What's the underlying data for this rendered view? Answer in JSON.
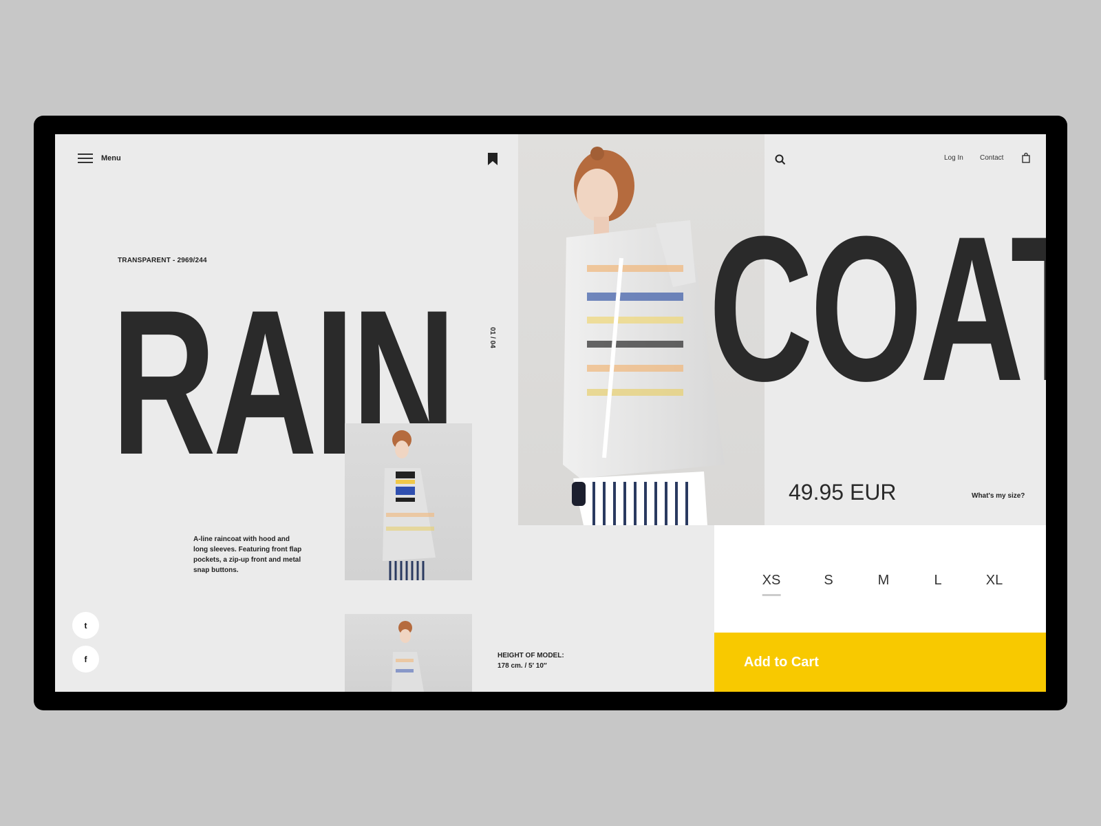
{
  "header": {
    "menu_label": "Menu",
    "nav_login": "Log In",
    "nav_contact": "Contact"
  },
  "product": {
    "sku": "TRANSPARENT - 2969/244",
    "title_left": "RAIN",
    "title_right": "COAT",
    "counter": "01 / 04",
    "description": "A-line raincoat with hood and long sleeves. Featuring front flap pockets, a zip-up front and metal snap buttons.",
    "model_height_label": "HEIGHT OF MODEL:",
    "model_height_value": "178 cm. / 5′ 10″",
    "price": "49.95 EUR",
    "size_help": "What's my size?",
    "sizes": [
      "XS",
      "S",
      "M",
      "L",
      "XL"
    ],
    "selected_size": "XS",
    "add_to_cart": "Add to Cart"
  },
  "social": {
    "twitter": "t",
    "facebook": "f"
  },
  "colors": {
    "accent": "#f8c900",
    "background": "#ebebeb",
    "text": "#2a2a2a",
    "device": "#000000",
    "page": "#c7c7c7"
  },
  "icons": [
    "hamburger-icon",
    "bookmark-icon",
    "search-icon",
    "shopping-bag-icon",
    "twitter-icon",
    "facebook-icon"
  ]
}
